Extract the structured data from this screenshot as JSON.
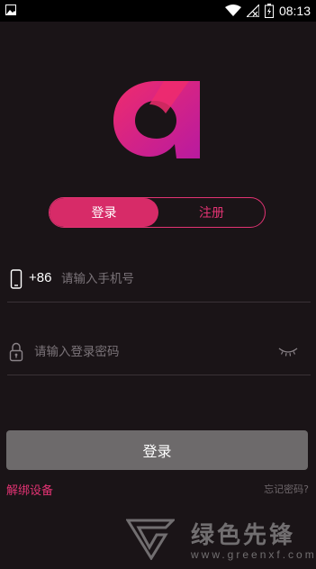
{
  "status_bar": {
    "time": "08:13",
    "icons": [
      "image-icon",
      "wifi-icon",
      "no-signal-icon",
      "battery-charging-icon"
    ]
  },
  "logo": {
    "icon": "app-logo-icon",
    "colors": [
      "#ef2c6d",
      "#b81aa0"
    ]
  },
  "tabs": [
    {
      "label": "登录",
      "active": true
    },
    {
      "label": "注册",
      "active": false
    }
  ],
  "phone_field": {
    "icon": "phone-icon",
    "prefix": "+86",
    "placeholder": "请输入手机号",
    "value": ""
  },
  "password_field": {
    "icon": "lock-icon",
    "placeholder": "请输入登录密码",
    "value": "",
    "toggle_icon": "eye-closed-icon"
  },
  "submit_label": "登录",
  "links": {
    "unbind": "解绑设备",
    "forgot": "忘记密码?"
  },
  "watermark": {
    "title": "绿色先锋",
    "url": "www.greenxf.com"
  },
  "colors": {
    "accent": "#e23373",
    "background": "#1a1417",
    "button": "#6d6a6b"
  }
}
